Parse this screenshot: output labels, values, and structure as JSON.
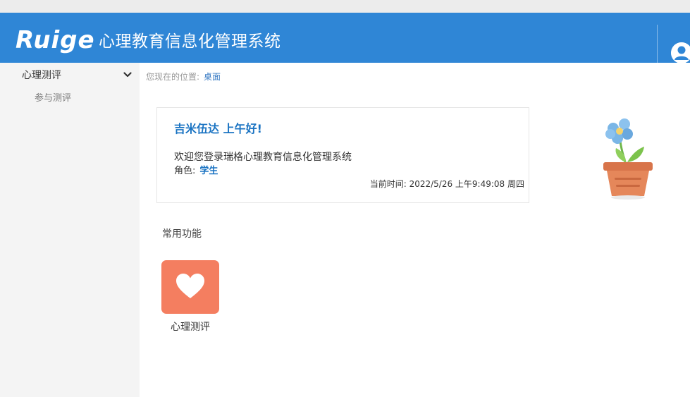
{
  "header": {
    "logo_text": "Ruige",
    "app_title": "心理教育信息化管理系统",
    "user_icon": "user-avatar-icon"
  },
  "sidebar": {
    "group_label": "心理测评",
    "group_icon": "chevron-down-icon",
    "items": [
      {
        "label": "参与测评"
      }
    ]
  },
  "breadcrumb": {
    "prefix": "您现在的位置:",
    "current": "桌面"
  },
  "welcome": {
    "greeting": "吉米伍达 上午好!",
    "message": "欢迎您登录瑞格心理教育信息化管理系统",
    "role_label": "角色:",
    "role_value": "学生",
    "time_text": "当前时间: 2022/5/26 上午9:49:08 周四",
    "decoration_icon": "flower-pot-icon"
  },
  "common_functions": {
    "title": "常用功能",
    "items": [
      {
        "label": "心理测评",
        "icon": "heart-icon",
        "color": "#f47e60"
      }
    ]
  },
  "colors": {
    "header_bg": "#2f86d6",
    "accent_text": "#1a73c2",
    "sidebar_bg": "#f4f4f4",
    "tile_bg": "#f47e60"
  }
}
